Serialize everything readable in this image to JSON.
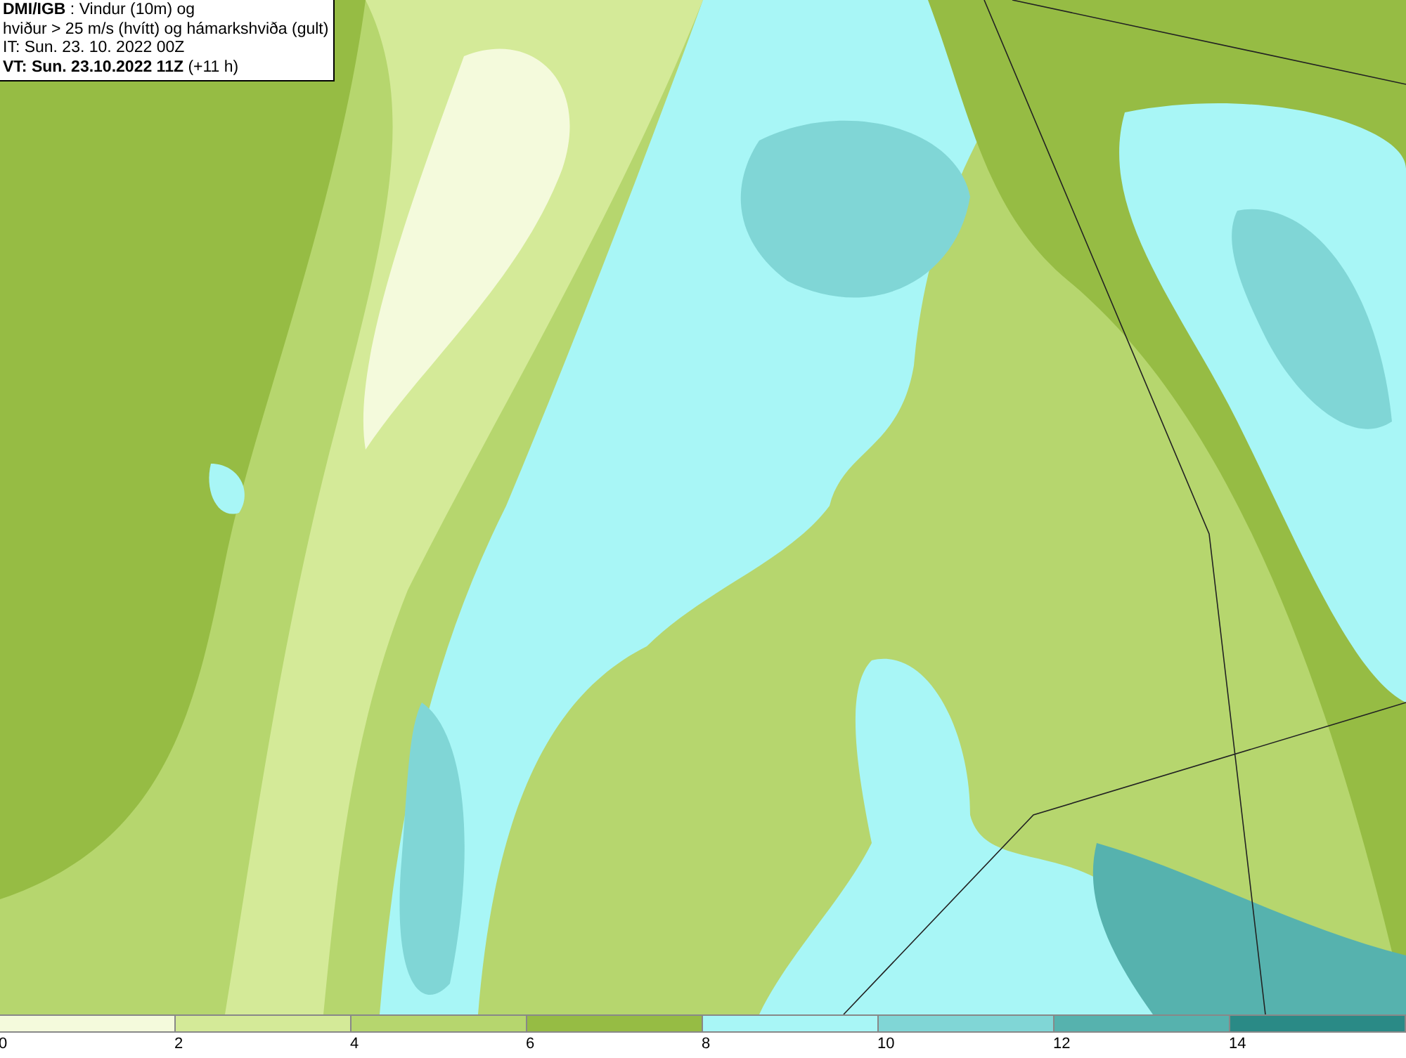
{
  "title_box": {
    "lines": [
      "**DMI/IGB** : Vindur (10m) og",
      "hviður > 25 m/s (hvítt) og hámarkshviða (gult)",
      "IT: Sun. 23. 10. 2022 00Z",
      "**VT: Sun. 23.10.2022 11Z** (+11 h)"
    ]
  },
  "legend": {
    "bins": [
      {
        "label": "0",
        "color": "#f4fadc"
      },
      {
        "label": "2",
        "color": "#d4ea98"
      },
      {
        "label": "4",
        "color": "#b6d66e"
      },
      {
        "label": "6",
        "color": "#96bc44"
      },
      {
        "label": "8",
        "color": "#a8f6f6"
      },
      {
        "label": "10",
        "color": "#80d6d6"
      },
      {
        "label": "12",
        "color": "#56b2ae"
      },
      {
        "label": "14",
        "color": "#2a8a86"
      }
    ]
  }
}
